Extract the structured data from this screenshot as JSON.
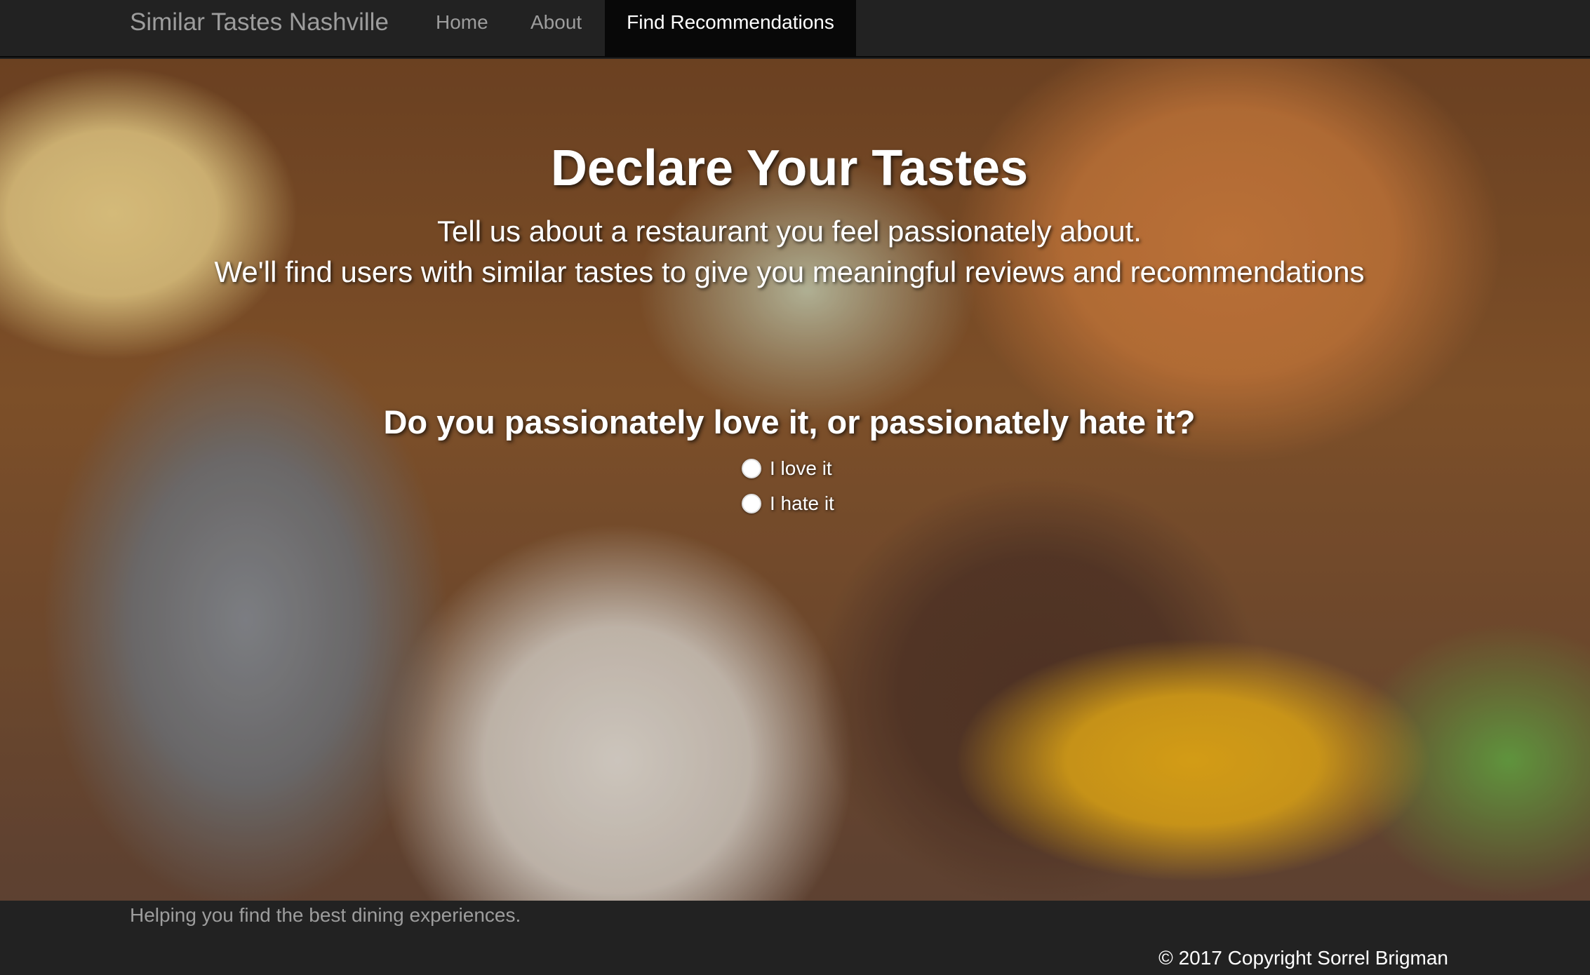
{
  "navbar": {
    "brand": "Similar Tastes Nashville",
    "links": [
      {
        "label": "Home"
      },
      {
        "label": "About"
      },
      {
        "label": "Find Recommendations",
        "active": true
      }
    ]
  },
  "hero": {
    "title": "Declare Your Tastes",
    "lead_line1": "Tell us about a restaurant you feel passionately about.",
    "lead_line2": "We'll find users with similar tastes to give you meaningful reviews and recommendations",
    "question": "Do you passionately love it, or passionately hate it?",
    "options": [
      {
        "label": "I love it",
        "selected": false
      },
      {
        "label": "I hate it",
        "selected": false
      }
    ]
  },
  "footer": {
    "tagline": "Helping you find the best dining experiences.",
    "copyright": "© 2017 Copyright Sorrel Brigman"
  },
  "colors": {
    "navbar_bg": "#222222",
    "active_link_bg": "#080808",
    "muted_text": "#9d9d9d",
    "white": "#ffffff"
  }
}
